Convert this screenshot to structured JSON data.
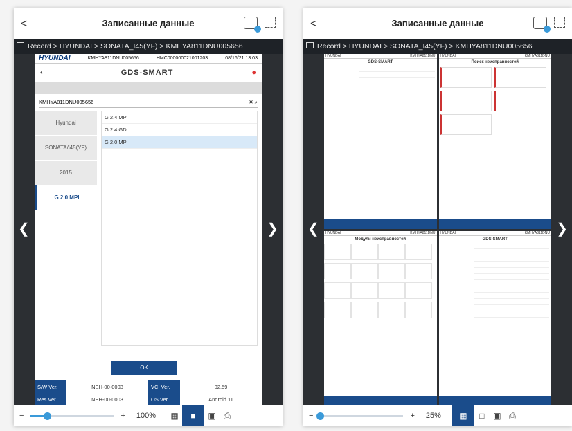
{
  "left": {
    "back": "<",
    "title": "Записанные данные",
    "breadcrumb": "Record > HYUNDAI > SONATA_I45(YF) > KMHYA811DNU005656",
    "screen": {
      "brand": "HYUNDAI",
      "vin_top": "KMHYA811DNU005656",
      "device_id": "HMC000000021001203",
      "datetime": "08/16/21 13:03",
      "app_logo": "GDS-SMART",
      "vin_input": "KMHYA811DNU005656",
      "left_items": [
        "Hyundai",
        "SONATA/i45(YF)",
        "2015",
        "G 2.0 MPI"
      ],
      "options": [
        "G 2.4 MPI",
        "G 2.4 GDI",
        "G 2.0 MPI"
      ],
      "ok": "OK",
      "sw_ver_label": "S/W Ver.",
      "sw_ver": "NEH-00-0003",
      "vci_ver_label": "VCI Ver.",
      "vci_ver": "02.59",
      "res_ver_label": "Res Ver.",
      "res_ver": "NEH-00-0003",
      "os_ver_label": "OS Ver.",
      "os_ver": "Android 11"
    },
    "bottom": {
      "minus": "−",
      "plus": "+",
      "zoom": "100%",
      "zoom_level": 0.2
    }
  },
  "right": {
    "back": "<",
    "title": "Записанные данные",
    "breadcrumb": "Record > HYUNDAI > SONATA_I45(YF) > KMHYA811DNU005656",
    "mini_titles": [
      "GDS-SMART",
      "Поиск неисправностей",
      "Модули неисправностей",
      "GDS-SMART"
    ],
    "bottom": {
      "minus": "−",
      "plus": "+",
      "zoom": "25%",
      "zoom_level": 0.0
    }
  },
  "icons": {
    "grid": "grid-view-icon",
    "single": "single-view-icon",
    "gallery": "gallery-icon",
    "print": "print-icon"
  }
}
